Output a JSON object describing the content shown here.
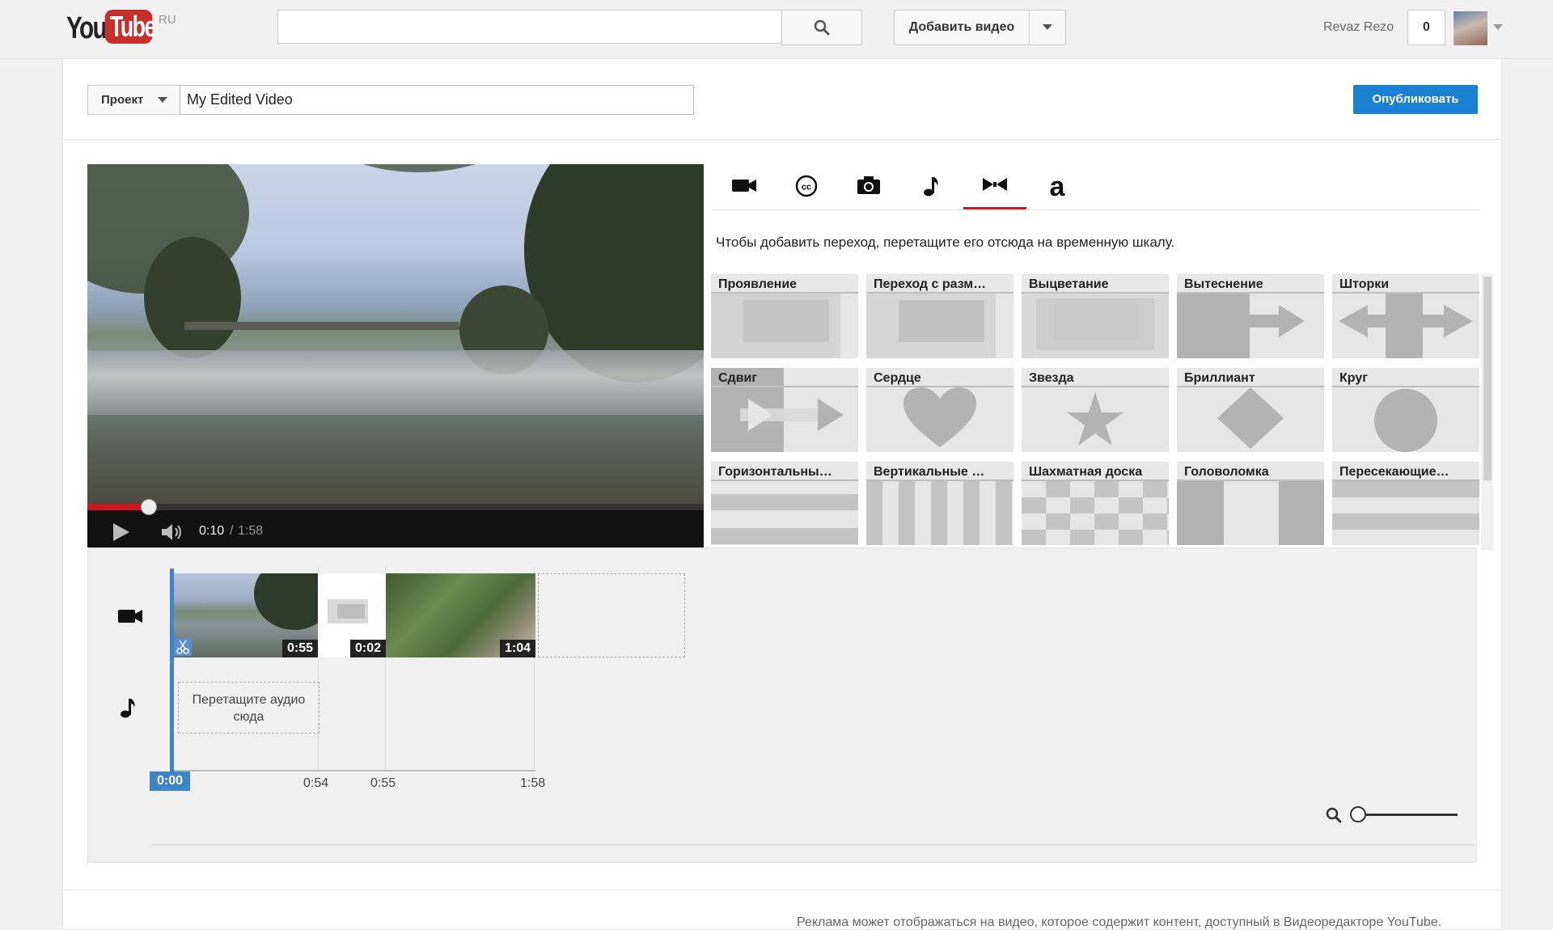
{
  "topbar": {
    "logo_left": "You",
    "logo_right": "Tube",
    "logo_region": "RU",
    "search_value": "",
    "add_video_label": "Добавить видео",
    "username": "Revaz Rezo",
    "notification_count": "0"
  },
  "project": {
    "menu_label": "Проект",
    "title_value": "My Edited Video",
    "publish_label": "Опубликовать"
  },
  "player": {
    "current_time": "0:10",
    "separator": "/",
    "total_time": "1:58",
    "progress": 0.1
  },
  "tabs": [
    {
      "icon": "video-camera-icon"
    },
    {
      "icon": "closed-captions-icon"
    },
    {
      "icon": "camera-icon"
    },
    {
      "icon": "music-note-icon"
    },
    {
      "icon": "bowtie-transitions-icon",
      "active": true
    },
    {
      "icon": "text-a-icon"
    }
  ],
  "transitions": {
    "instruction": "Чтобы добавить переход, перетащите его отсюда на временную шкалу.",
    "items": [
      "Проявление",
      "Переход с разм…",
      "Выцветание",
      "Вытеснение",
      "Шторки",
      "Сдвиг",
      "Сердце",
      "Звезда",
      "Бриллиант",
      "Круг",
      "Горизонтальны…",
      "Вертикальные …",
      "Шахматная доска",
      "Головоломка",
      "Пересекающие…"
    ]
  },
  "timeline": {
    "clips": [
      {
        "duration": "0:55"
      },
      {
        "duration": "0:02"
      },
      {
        "duration": "1:04"
      }
    ],
    "audio_drop_label": "Перетащите аудио сюда",
    "playhead_label": "0:00",
    "ticks": [
      "0:54",
      "0:55",
      "1:58"
    ]
  },
  "footer": {
    "text": "Реклама может отображаться на видео, которое содержит контент, доступный в Видеоредакторе YouTube."
  },
  "colors": {
    "accent_red": "#cc181e",
    "publish_blue": "#1b7fd2",
    "playhead_blue": "#3c85c7"
  }
}
